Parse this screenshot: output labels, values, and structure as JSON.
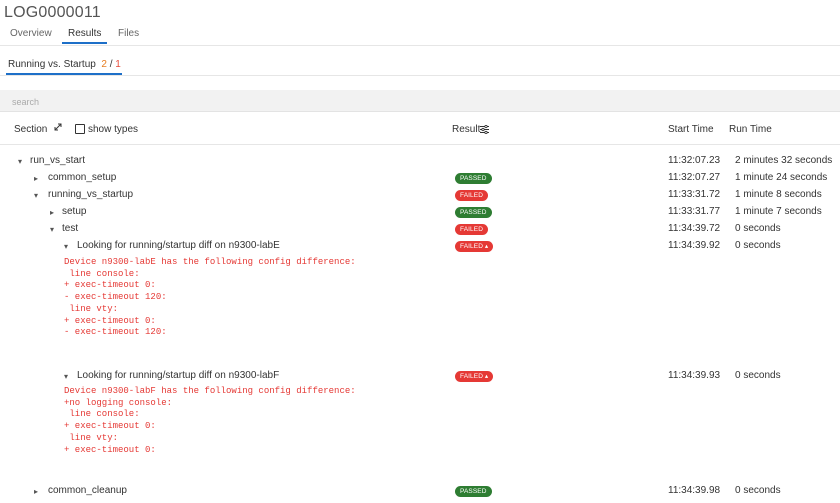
{
  "header": {
    "title": "LOG0000011"
  },
  "tabs": [
    {
      "label": "Overview",
      "active": false
    },
    {
      "label": "Results",
      "active": true
    },
    {
      "label": "Files",
      "active": false
    }
  ],
  "subtab": {
    "label": "Running vs. Startup",
    "passed": "2",
    "separator": " / ",
    "failed": "1"
  },
  "search": {
    "placeholder": "search"
  },
  "table_header": {
    "section": "Section",
    "show_types": "show types",
    "result": "Result",
    "start_time": "Start Time",
    "run_time": "Run Time"
  },
  "rows": [
    {
      "name": "run_vs_start",
      "toggle": "▾",
      "result": "",
      "start": "11:32:07.23",
      "runtime": "2 minutes 32 seconds"
    },
    {
      "name": "common_setup",
      "toggle": "▸",
      "result": "PASSED",
      "start": "11:32:07.27",
      "runtime": "1 minute 24 seconds"
    },
    {
      "name": "running_vs_startup",
      "toggle": "▾",
      "result": "FAILED",
      "start": "11:33:31.72",
      "runtime": "1 minute 8 seconds"
    },
    {
      "name": "setup",
      "toggle": "▸",
      "result": "PASSED",
      "start": "11:33:31.77",
      "runtime": "1 minute 7 seconds"
    },
    {
      "name": "test",
      "toggle": "▾",
      "result": "FAILED",
      "start": "11:34:39.72",
      "runtime": "0 seconds"
    },
    {
      "name": "Looking for running/startup diff on n9300-labE",
      "toggle": "▾",
      "result": "FAILED ▴",
      "start": "11:34:39.92",
      "runtime": "0 seconds"
    },
    {
      "name": "Looking for running/startup diff on n9300-labF",
      "toggle": "▾",
      "result": "FAILED ▴",
      "start": "11:34:39.93",
      "runtime": "0 seconds"
    },
    {
      "name": "common_cleanup",
      "toggle": "▸",
      "result": "PASSED",
      "start": "11:34:39.98",
      "runtime": "0 seconds"
    }
  ],
  "logs": {
    "labE": [
      "Device n9300-labE has the following config difference:",
      " line console:",
      "+ exec-timeout 0:",
      "- exec-timeout 120:",
      " line vty:",
      "+ exec-timeout 0:",
      "- exec-timeout 120:"
    ],
    "labF": [
      "Device n9300-labF has the following config difference:",
      "+no logging console:",
      " line console:",
      "+ exec-timeout 0:",
      " line vty:",
      "+ exec-timeout 0:"
    ]
  },
  "colors": {
    "accent": "#1d6fc8",
    "passed": "#2e7d32",
    "failed": "#e53935",
    "subtab_passed": "#e67e22"
  },
  "icons": {
    "expand": "expand-arrows-icon",
    "checkbox": "checkbox-icon",
    "filter": "filter-sliders-icon",
    "expanded": "caret-down-icon",
    "collapsed": "caret-right-icon"
  }
}
